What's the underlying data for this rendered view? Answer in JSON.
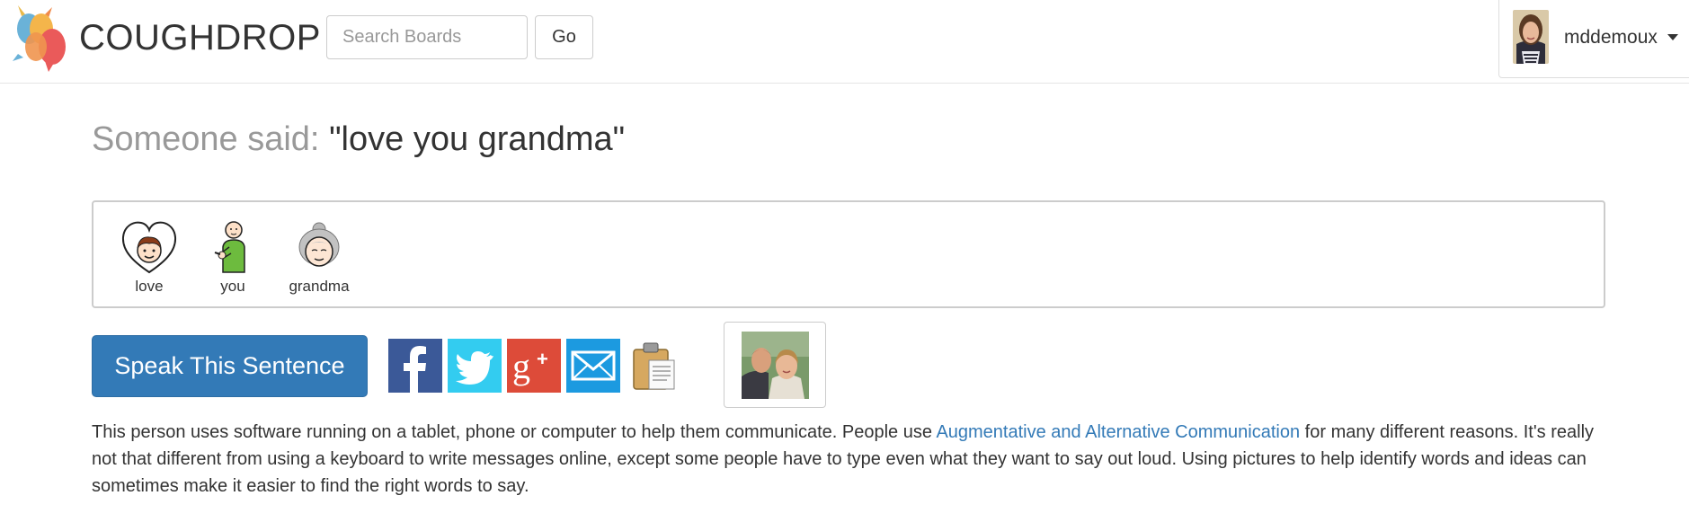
{
  "header": {
    "app_name": "COUGHDROP",
    "search": {
      "placeholder": "Search Boards",
      "value": ""
    },
    "go_label": "Go",
    "user": {
      "name": "mddemoux"
    }
  },
  "main": {
    "said_label": "Someone said:",
    "said_quote": "\"love you grandma\"",
    "words": [
      {
        "label": "love",
        "icon": "heart-boy-icon"
      },
      {
        "label": "you",
        "icon": "person-pointing-icon"
      },
      {
        "label": "grandma",
        "icon": "grandma-icon"
      }
    ],
    "speak_label": "Speak This Sentence",
    "share": [
      "facebook-icon",
      "twitter-icon",
      "google-plus-icon",
      "email-icon",
      "clipboard-icon"
    ],
    "info": {
      "part1": "This person uses software running on a tablet, phone or computer to help them communicate. People use ",
      "link": "Augmentative and Alternative Communication",
      "part2": " for many different reasons. It's really not that different from using a keyboard to write messages online, except some people have to type even what they want to say out loud. Using pictures to help identify words and ideas can sometimes make it easier to find the right words to say."
    }
  },
  "colors": {
    "primary": "#337ab7",
    "facebook": "#3b5998",
    "twitter": "#33ccf0",
    "google_plus": "#dd4b39",
    "email": "#1c9ae0",
    "muted": "#999999"
  }
}
